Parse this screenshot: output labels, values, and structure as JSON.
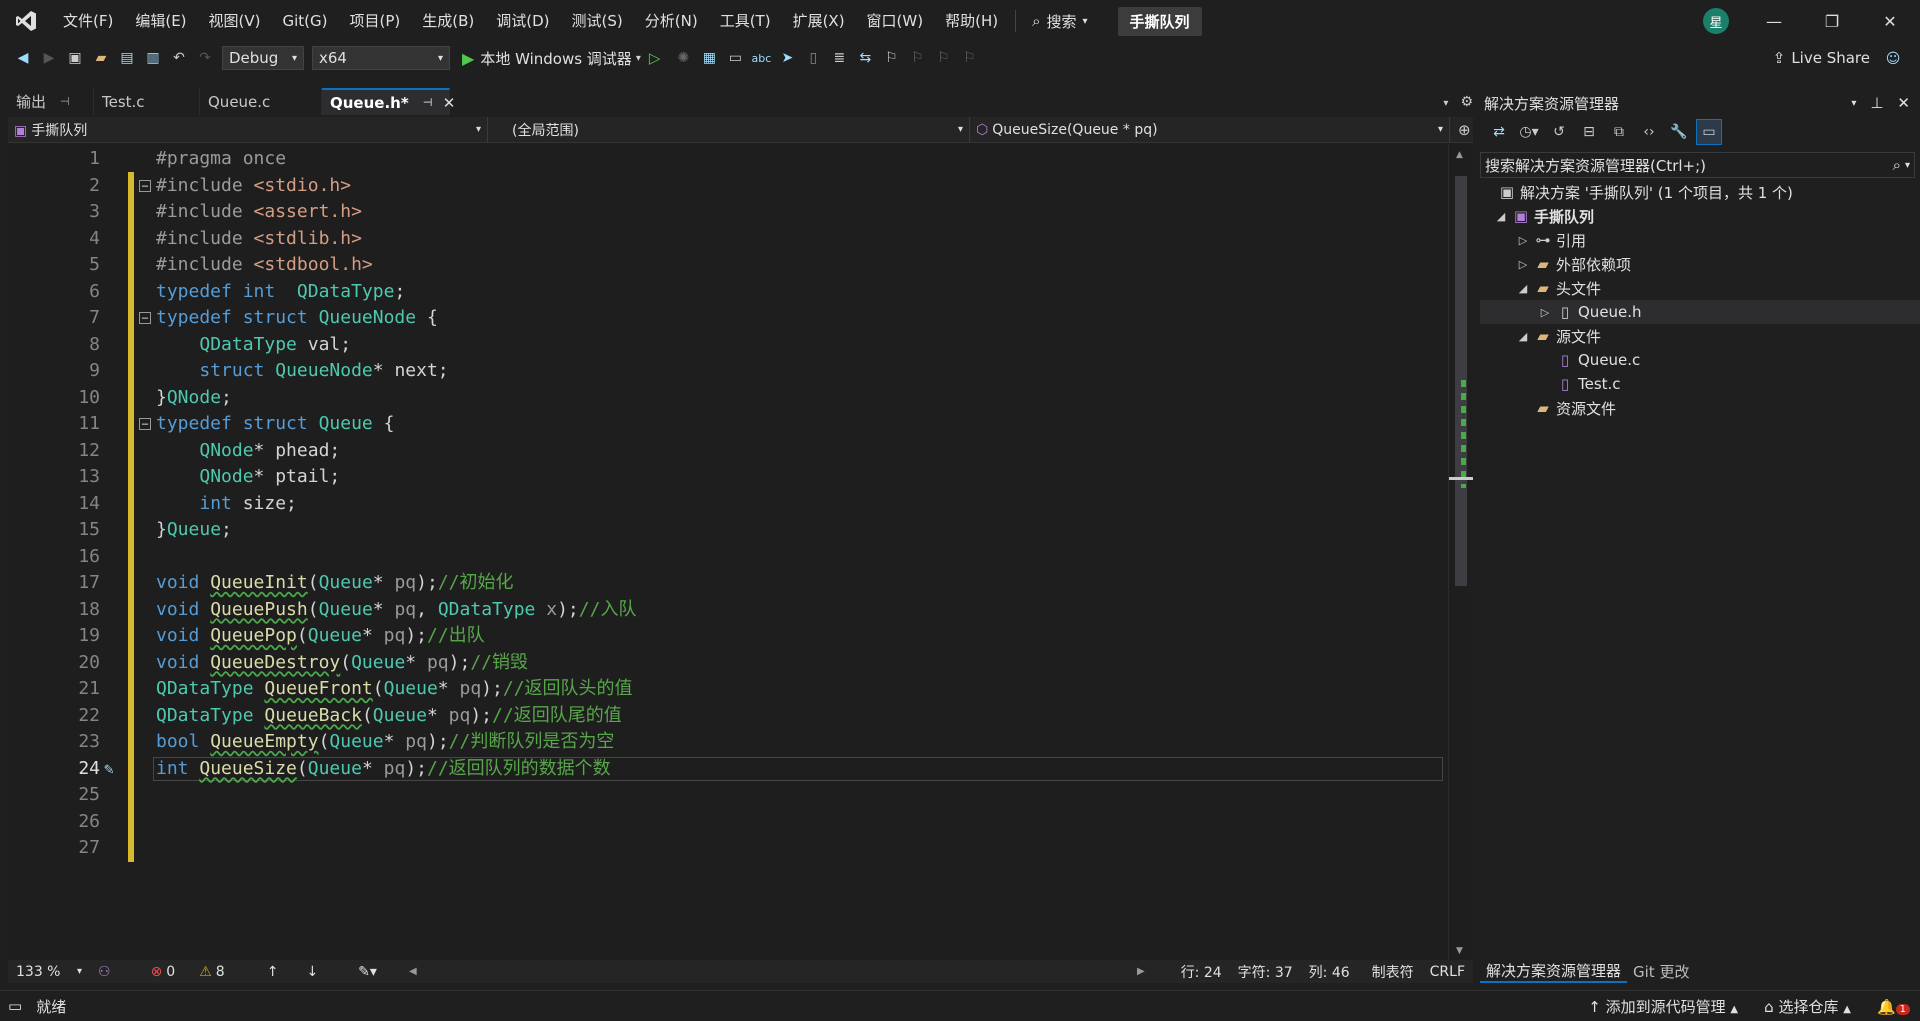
{
  "menu": {
    "items": [
      "文件(F)",
      "编辑(E)",
      "视图(V)",
      "Git(G)",
      "项目(P)",
      "生成(B)",
      "调试(D)",
      "测试(S)",
      "分析(N)",
      "工具(T)",
      "扩展(X)",
      "窗口(W)",
      "帮助(H)"
    ],
    "search_label": "搜索",
    "solution_name": "手撕队列",
    "avatar_letter": "星"
  },
  "toolbar": {
    "config": "Debug",
    "platform": "x64",
    "debugger": "本地 Windows 调试器",
    "live_share": "Live Share"
  },
  "tabs": [
    {
      "label": "输出",
      "pinned": true,
      "active": false
    },
    {
      "label": "Test.c",
      "active": false
    },
    {
      "label": "Queue.c",
      "active": false
    },
    {
      "label": "Queue.h*",
      "active": true
    }
  ],
  "navbar": {
    "project": "手撕队列",
    "scope": "(全局范围)",
    "member": "QueueSize(Queue * pq)"
  },
  "code_lines": [
    "#pragma once",
    "#include <stdio.h>",
    "#include <assert.h>",
    "#include <stdlib.h>",
    "#include <stdbool.h>",
    "typedef int  QDataType;",
    "typedef struct QueueNode {",
    "    QDataType val;",
    "    struct QueueNode* next;",
    "}QNode;",
    "typedef struct Queue {",
    "    QNode* phead;",
    "    QNode* ptail;",
    "    int size;",
    "}Queue;",
    "",
    "void QueueInit(Queue* pq);//初始化",
    "void QueuePush(Queue* pq, QDataType x);//入队",
    "void QueuePop(Queue* pq);//出队",
    "void QueueDestroy(Queue* pq);//销毁",
    "QDataType QueueFront(Queue* pq);//返回队头的值",
    "QDataType QueueBack(Queue* pq);//返回队尾的值",
    "bool QueueEmpty(Queue* pq);//判断队列是否为空",
    "int QueueSize(Queue* pq);//返回队列的数据个数",
    "",
    "",
    ""
  ],
  "current_line": 24,
  "editor_status": {
    "zoom": "133 %",
    "errors": "0",
    "warnings": "8",
    "line": "行: 24",
    "char": "字符: 37",
    "col": "列: 46",
    "tabs": "制表符",
    "eol": "CRLF"
  },
  "solution_explorer": {
    "title": "解决方案资源管理器",
    "search_placeholder": "搜索解决方案资源管理器(Ctrl+;)",
    "solution_line": "解决方案 '手撕队列' (1 个项目，共 1 个)",
    "project": "手撕队列",
    "references": "引用",
    "external_deps": "外部依赖项",
    "headers": "头文件",
    "header_file": "Queue.h",
    "sources": "源文件",
    "source_1": "Queue.c",
    "source_2": "Test.c",
    "resources": "资源文件",
    "tab_explorer": "解决方案资源管理器",
    "tab_git": "Git 更改"
  },
  "statusbar": {
    "ready": "就绪",
    "add_source": "添加到源代码管理",
    "select_repo": "选择仓库",
    "notifications": "1"
  }
}
